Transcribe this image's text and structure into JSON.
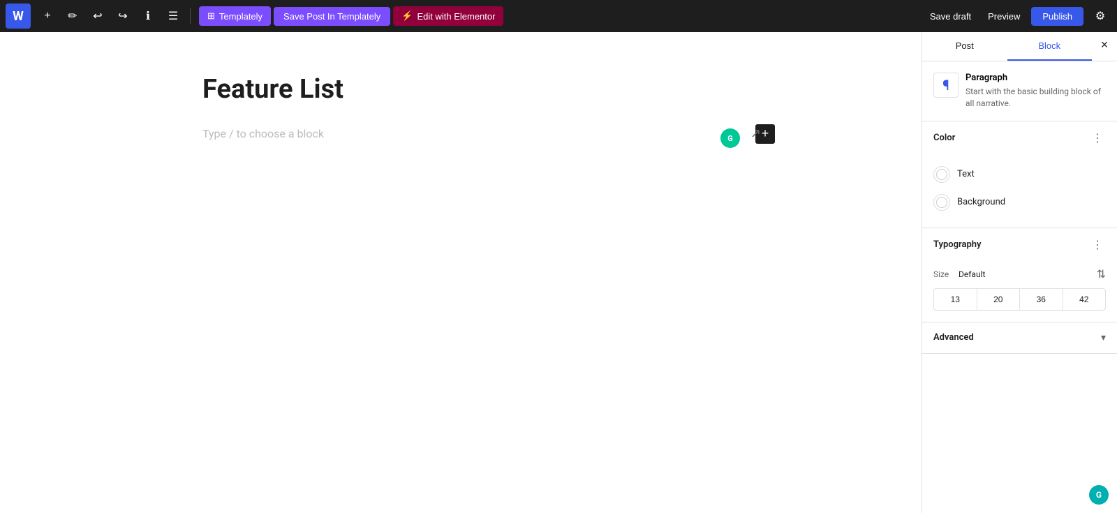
{
  "toolbar": {
    "wp_logo": "W",
    "add_label": "+",
    "tool_label": "✏",
    "undo_label": "↩",
    "redo_label": "↪",
    "info_label": "ℹ",
    "menu_label": "☰",
    "templately_label": "Templately",
    "save_post_label": "Save Post In Templately",
    "elementor_label": "Edit with Elementor",
    "save_draft_label": "Save draft",
    "preview_label": "Preview",
    "publish_label": "Publish",
    "settings_label": "⚙"
  },
  "editor": {
    "post_title": "Feature List",
    "block_placeholder": "Type / to choose a block"
  },
  "sidebar": {
    "tab_post": "Post",
    "tab_block": "Block",
    "active_tab": "block",
    "close_label": "×",
    "block_icon": "¶",
    "block_name": "Paragraph",
    "block_description": "Start with the basic building block of all narrative.",
    "color_section_label": "Color",
    "color_options": [
      {
        "label": "Text"
      },
      {
        "label": "Background"
      }
    ],
    "typography_section_label": "Typography",
    "font_size_label": "Size",
    "font_size_value": "Default",
    "font_size_presets": [
      "13",
      "20",
      "36",
      "42"
    ],
    "advanced_section_label": "Advanced"
  }
}
